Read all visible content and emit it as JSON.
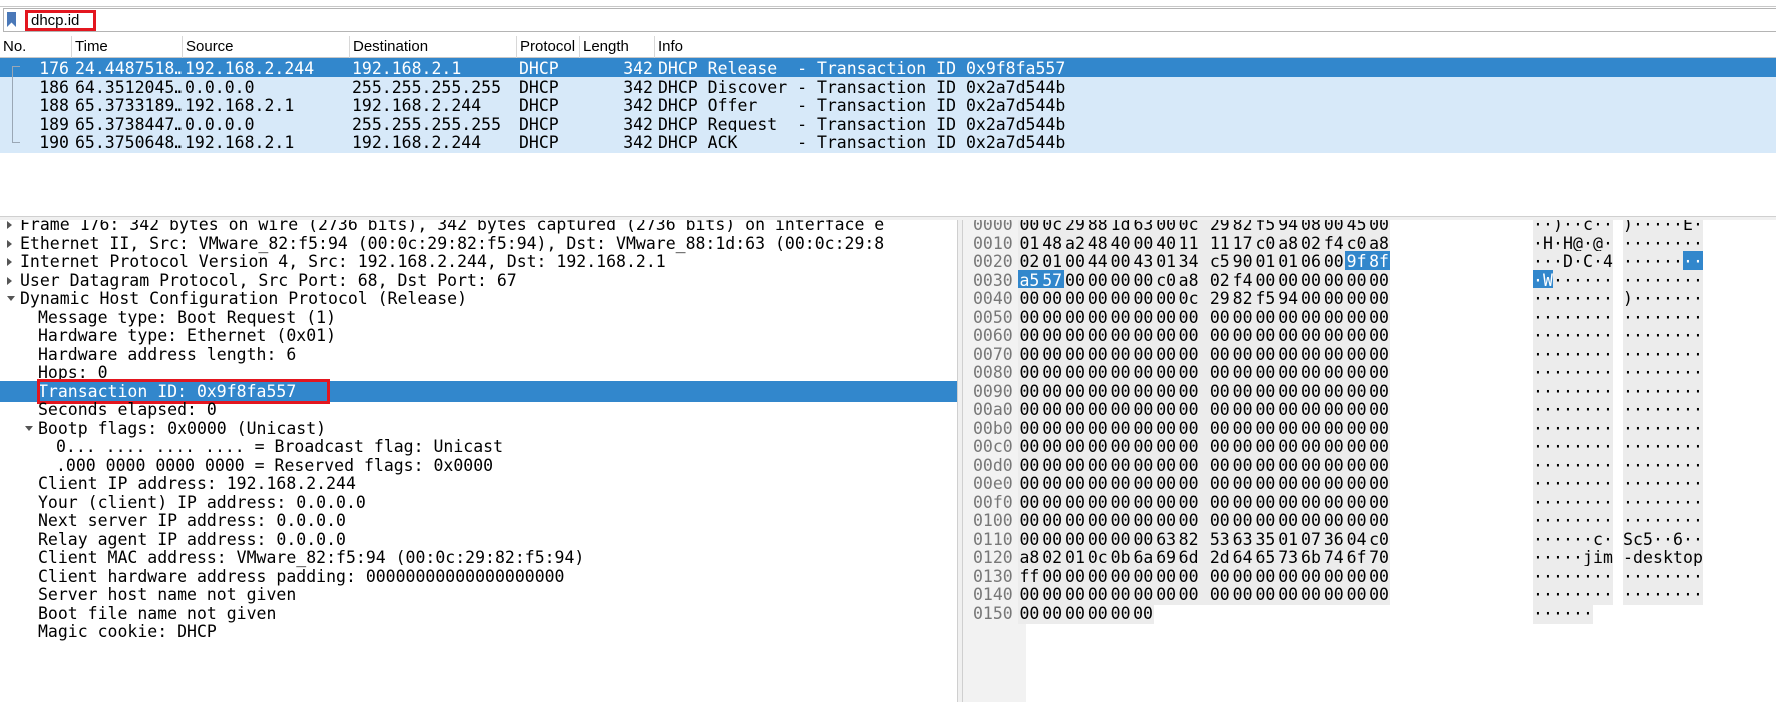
{
  "filter": {
    "text": "dhcp.id",
    "bookmark_icon": "bookmark-icon",
    "highlight_color": "#e3161f"
  },
  "packet_list": {
    "columns": [
      "No.",
      "Time",
      "Source",
      "Destination",
      "Protocol",
      "Length",
      "Info"
    ],
    "rows": [
      {
        "no": "176",
        "time": "24.4487518…",
        "source": "192.168.2.244",
        "destination": "192.168.2.1",
        "protocol": "DHCP",
        "length": "342",
        "info": "DHCP Release  - Transaction ID 0x9f8fa557",
        "selected": true
      },
      {
        "no": "186",
        "time": "64.3512045…",
        "source": "0.0.0.0",
        "destination": "255.255.255.255",
        "protocol": "DHCP",
        "length": "342",
        "info": "DHCP Discover - Transaction ID 0x2a7d544b",
        "selected": false
      },
      {
        "no": "188",
        "time": "65.3733189…",
        "source": "192.168.2.1",
        "destination": "192.168.2.244",
        "protocol": "DHCP",
        "length": "342",
        "info": "DHCP Offer    - Transaction ID 0x2a7d544b",
        "selected": false
      },
      {
        "no": "189",
        "time": "65.3738447…",
        "source": "0.0.0.0",
        "destination": "255.255.255.255",
        "protocol": "DHCP",
        "length": "342",
        "info": "DHCP Request  - Transaction ID 0x2a7d544b",
        "selected": false
      },
      {
        "no": "190",
        "time": "65.3750648…",
        "source": "192.168.2.1",
        "destination": "192.168.2.244",
        "protocol": "DHCP",
        "length": "342",
        "info": "DHCP ACK      - Transaction ID 0x2a7d544b",
        "selected": false
      }
    ]
  },
  "details": {
    "rows": [
      {
        "text": "Frame 176: 342 bytes on wire (2736 bits), 342 bytes captured (2736 bits) on interface e",
        "level": 0,
        "arrow": "right",
        "selected": false
      },
      {
        "text": "Ethernet II, Src: VMware_82:f5:94 (00:0c:29:82:f5:94), Dst: VMware_88:1d:63 (00:0c:29:8",
        "level": 0,
        "arrow": "right",
        "selected": false
      },
      {
        "text": "Internet Protocol Version 4, Src: 192.168.2.244, Dst: 192.168.2.1",
        "level": 0,
        "arrow": "right",
        "selected": false
      },
      {
        "text": "User Datagram Protocol, Src Port: 68, Dst Port: 67",
        "level": 0,
        "arrow": "right",
        "selected": false
      },
      {
        "text": "Dynamic Host Configuration Protocol (Release)",
        "level": 0,
        "arrow": "down",
        "selected": false
      },
      {
        "text": "Message type: Boot Request (1)",
        "level": 1,
        "arrow": "",
        "selected": false
      },
      {
        "text": "Hardware type: Ethernet (0x01)",
        "level": 1,
        "arrow": "",
        "selected": false
      },
      {
        "text": "Hardware address length: 6",
        "level": 1,
        "arrow": "",
        "selected": false
      },
      {
        "text": "Hops: 0",
        "level": 1,
        "arrow": "",
        "selected": false
      },
      {
        "text": "Transaction ID: 0x9f8fa557",
        "level": 1,
        "arrow": "",
        "selected": true
      },
      {
        "text": "Seconds elapsed: 0",
        "level": 1,
        "arrow": "",
        "selected": false
      },
      {
        "text": "Bootp flags: 0x0000 (Unicast)",
        "level": 1,
        "arrow": "down",
        "selected": false
      },
      {
        "text": "0... .... .... .... = Broadcast flag: Unicast",
        "level": 2,
        "arrow": "",
        "selected": false
      },
      {
        "text": ".000 0000 0000 0000 = Reserved flags: 0x0000",
        "level": 2,
        "arrow": "",
        "selected": false
      },
      {
        "text": "Client IP address: 192.168.2.244",
        "level": 1,
        "arrow": "",
        "selected": false
      },
      {
        "text": "Your (client) IP address: 0.0.0.0",
        "level": 1,
        "arrow": "",
        "selected": false
      },
      {
        "text": "Next server IP address: 0.0.0.0",
        "level": 1,
        "arrow": "",
        "selected": false
      },
      {
        "text": "Relay agent IP address: 0.0.0.0",
        "level": 1,
        "arrow": "",
        "selected": false
      },
      {
        "text": "Client MAC address: VMware_82:f5:94 (00:0c:29:82:f5:94)",
        "level": 1,
        "arrow": "",
        "selected": false
      },
      {
        "text": "Client hardware address padding: 00000000000000000000",
        "level": 1,
        "arrow": "",
        "selected": false
      },
      {
        "text": "Server host name not given",
        "level": 1,
        "arrow": "",
        "selected": false
      },
      {
        "text": "Boot file name not given",
        "level": 1,
        "arrow": "",
        "selected": false
      },
      {
        "text": "Magic cookie: DHCP",
        "level": 1,
        "arrow": "",
        "selected": false
      }
    ]
  },
  "hex": {
    "rows": [
      {
        "offset": "0000",
        "bytes": "00 0c 29 88 1d 63 00 0c 29 82 f5 94 08 00 45 00",
        "ascii": "··)··c·· )·····E·"
      },
      {
        "offset": "0010",
        "bytes": "01 48 a2 48 40 00 40 11 11 17 c0 a8 02 f4 c0 a8",
        "ascii": "·H·H@·@· ········"
      },
      {
        "offset": "0020",
        "bytes": "02 01 00 44 00 43 01 34 c5 90 01 01 06 00 9f 8f",
        "ascii": "···D·C·4 ········"
      },
      {
        "offset": "0030",
        "bytes": "a5 57 00 00 00 00 c0 a8 02 f4 00 00 00 00 00 00",
        "ascii": "·W······ ········"
      },
      {
        "offset": "0040",
        "bytes": "00 00 00 00 00 00 00 0c 29 82 f5 94 00 00 00 00",
        "ascii": "········ )·······"
      },
      {
        "offset": "0050",
        "bytes": "00 00 00 00 00 00 00 00 00 00 00 00 00 00 00 00",
        "ascii": "········ ········"
      },
      {
        "offset": "0060",
        "bytes": "00 00 00 00 00 00 00 00 00 00 00 00 00 00 00 00",
        "ascii": "········ ········"
      },
      {
        "offset": "0070",
        "bytes": "00 00 00 00 00 00 00 00 00 00 00 00 00 00 00 00",
        "ascii": "········ ········"
      },
      {
        "offset": "0080",
        "bytes": "00 00 00 00 00 00 00 00 00 00 00 00 00 00 00 00",
        "ascii": "········ ········"
      },
      {
        "offset": "0090",
        "bytes": "00 00 00 00 00 00 00 00 00 00 00 00 00 00 00 00",
        "ascii": "········ ········"
      },
      {
        "offset": "00a0",
        "bytes": "00 00 00 00 00 00 00 00 00 00 00 00 00 00 00 00",
        "ascii": "········ ········"
      },
      {
        "offset": "00b0",
        "bytes": "00 00 00 00 00 00 00 00 00 00 00 00 00 00 00 00",
        "ascii": "········ ········"
      },
      {
        "offset": "00c0",
        "bytes": "00 00 00 00 00 00 00 00 00 00 00 00 00 00 00 00",
        "ascii": "········ ········"
      },
      {
        "offset": "00d0",
        "bytes": "00 00 00 00 00 00 00 00 00 00 00 00 00 00 00 00",
        "ascii": "········ ········"
      },
      {
        "offset": "00e0",
        "bytes": "00 00 00 00 00 00 00 00 00 00 00 00 00 00 00 00",
        "ascii": "········ ········"
      },
      {
        "offset": "00f0",
        "bytes": "00 00 00 00 00 00 00 00 00 00 00 00 00 00 00 00",
        "ascii": "········ ········"
      },
      {
        "offset": "0100",
        "bytes": "00 00 00 00 00 00 00 00 00 00 00 00 00 00 00 00",
        "ascii": "········ ········"
      },
      {
        "offset": "0110",
        "bytes": "00 00 00 00 00 00 63 82 53 63 35 01 07 36 04 c0",
        "ascii": "······c· Sc5··6··"
      },
      {
        "offset": "0120",
        "bytes": "a8 02 01 0c 0b 6a 69 6d 2d 64 65 73 6b 74 6f 70",
        "ascii": "·····jim -desktop"
      },
      {
        "offset": "0130",
        "bytes": "ff 00 00 00 00 00 00 00 00 00 00 00 00 00 00 00",
        "ascii": "········ ········"
      },
      {
        "offset": "0140",
        "bytes": "00 00 00 00 00 00 00 00 00 00 00 00 00 00 00 00",
        "ascii": "········ ········"
      },
      {
        "offset": "0150",
        "bytes": "00 00 00 00 00 00",
        "ascii": "······"
      }
    ],
    "selected_bytes": [
      "0020:14",
      "0020:15",
      "0030:0",
      "0030:1"
    ],
    "selected_color": "#3287cc"
  }
}
